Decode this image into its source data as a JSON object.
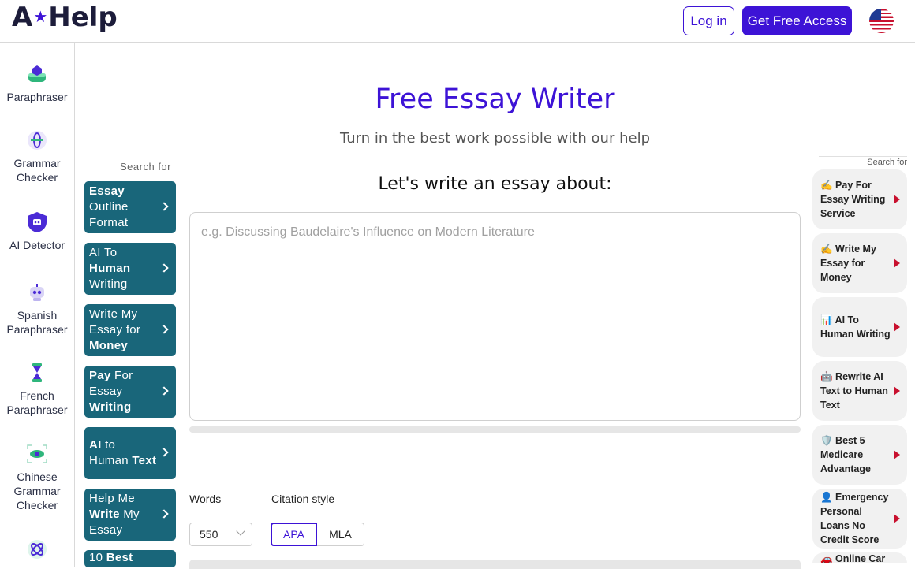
{
  "header": {
    "logo_a": "A",
    "logo_help": "Help",
    "login_label": "Log in",
    "access_label": "Get Free Access"
  },
  "sidebar": {
    "items": [
      {
        "label": "Paraphraser"
      },
      {
        "label": "Grammar Checker"
      },
      {
        "label": "AI Detector"
      },
      {
        "label": "Spanish Paraphraser"
      },
      {
        "label": "French Paraphraser"
      },
      {
        "label": "Chinese Grammar Checker"
      }
    ]
  },
  "main": {
    "title": "Free Essay Writer",
    "subtitle": "Turn in the best work possible with our help",
    "prompt": "Let's write an essay about:",
    "placeholder": "e.g. Discussing Baudelaire's Influence on Modern Literature",
    "words_label": "Words",
    "words_value": "550",
    "citation_label": "Citation style",
    "citation_options": [
      "APA",
      "MLA"
    ],
    "citation_selected": "APA"
  },
  "left_ads": {
    "label": "Search for",
    "items": [
      {
        "parts": [
          [
            "Essay",
            true
          ],
          [
            " Outline Format",
            false
          ]
        ]
      },
      {
        "parts": [
          [
            "AI To ",
            false
          ],
          [
            "Human",
            true
          ],
          [
            " Writing",
            false
          ]
        ]
      },
      {
        "parts": [
          [
            "Write My Essay for ",
            false
          ],
          [
            "Money",
            true
          ]
        ]
      },
      {
        "parts": [
          [
            "Pay",
            true
          ],
          [
            " For Essay ",
            false
          ],
          [
            "Writing",
            true
          ]
        ]
      },
      {
        "parts": [
          [
            "AI",
            true
          ],
          [
            " to Human ",
            false
          ],
          [
            "Text",
            true
          ]
        ]
      },
      {
        "parts": [
          [
            "Help Me ",
            false
          ],
          [
            "Write",
            true
          ],
          [
            " My Essay",
            false
          ]
        ]
      },
      {
        "parts": [
          [
            "10 ",
            false
          ],
          [
            "Best",
            true
          ]
        ]
      }
    ]
  },
  "right_ads": {
    "label": "Search for",
    "items": [
      {
        "label": "✍️ Pay For Essay Writing Service"
      },
      {
        "label": "✍️ Write My Essay for Money"
      },
      {
        "label": "📊 AI To Human Writing"
      },
      {
        "label": "🤖 Rewrite AI Text to Human Text"
      },
      {
        "label": "🛡️ Best 5 Medicare Advantage"
      },
      {
        "label": "👤 Emergency Personal Loans No Credit Score"
      },
      {
        "label": "🚗 Online Car"
      }
    ]
  },
  "colors": {
    "brand": "#3d13d6",
    "ad_teal": "#19667a",
    "ad_arrow_red": "#c8102e"
  }
}
